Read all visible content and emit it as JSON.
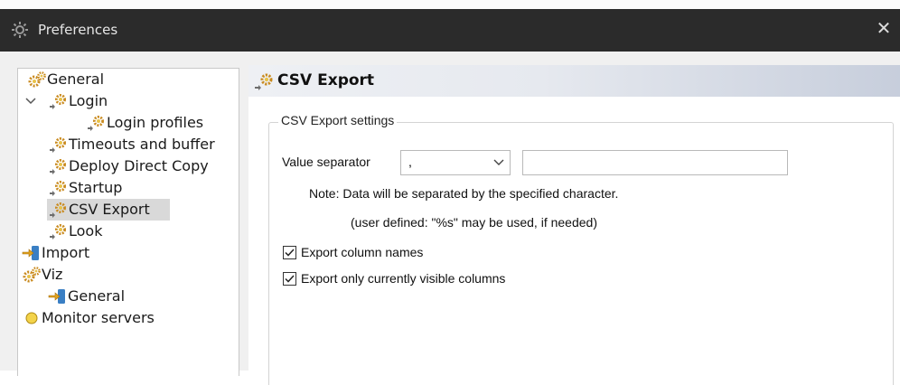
{
  "window": {
    "title": "Preferences",
    "close_glyph": "✕"
  },
  "tree": [
    {
      "label": "General",
      "icon": "gears-icon"
    },
    {
      "label": "Login",
      "icon": "gear-arrow-icon",
      "expanded": true
    },
    {
      "label": "Login profiles",
      "icon": "gear-arrow-icon"
    },
    {
      "label": "Timeouts and buffer",
      "icon": "gear-arrow-icon"
    },
    {
      "label": "Deploy Direct Copy",
      "icon": "gear-arrow-icon"
    },
    {
      "label": "Startup",
      "icon": "gear-arrow-icon"
    },
    {
      "label": "CSV Export",
      "icon": "gear-arrow-icon",
      "selected": true
    },
    {
      "label": "Look",
      "icon": "gear-arrow-icon"
    },
    {
      "label": "Import",
      "icon": "import-arrow-icon"
    },
    {
      "label": "Viz",
      "icon": "gears-icon"
    },
    {
      "label": "General",
      "icon": "import-arrow-icon"
    },
    {
      "label": "Monitor servers",
      "icon": "bulb-icon"
    }
  ],
  "page": {
    "title": "CSV Export",
    "group_title": "CSV Export settings",
    "value_separator_label": "Value separator",
    "separator_value": ",",
    "note_line1": "Note: Data will be separated by the specified character.",
    "note_line2": "(user defined: \"%s\" may be used, if needed)",
    "export_column_names": "Export column names",
    "export_visible_columns": "Export only currently visible columns",
    "export_column_names_checked": true,
    "export_visible_columns_checked": true
  },
  "colors": {
    "titlebar": "#2b2b2b",
    "selection": "#d9d9d9",
    "gear": "#c98a1e",
    "import": "#3a7fc4"
  }
}
